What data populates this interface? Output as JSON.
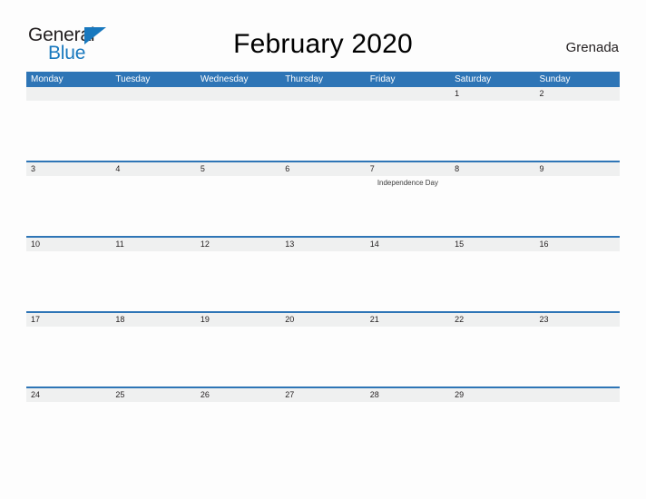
{
  "brand": {
    "name_part1": "General",
    "name_part2": "Blue",
    "flag_icon": "blue-triangle-flag",
    "accent_color": "#1878be"
  },
  "header": {
    "title": "February 2020",
    "region": "Grenada"
  },
  "theme": {
    "header_blue": "#2e75b6",
    "band_gray": "#eff0f0",
    "page_background": "#fdfdfd",
    "text_color": "#231f20"
  },
  "calendar": {
    "month": "February",
    "year": "2020",
    "weekday_headers": [
      "Monday",
      "Tuesday",
      "Wednesday",
      "Thursday",
      "Friday",
      "Saturday",
      "Sunday"
    ],
    "weeks": [
      {
        "days": [
          {
            "number": "",
            "event": ""
          },
          {
            "number": "",
            "event": ""
          },
          {
            "number": "",
            "event": ""
          },
          {
            "number": "",
            "event": ""
          },
          {
            "number": "",
            "event": ""
          },
          {
            "number": "1",
            "event": ""
          },
          {
            "number": "2",
            "event": ""
          }
        ]
      },
      {
        "days": [
          {
            "number": "3",
            "event": ""
          },
          {
            "number": "4",
            "event": ""
          },
          {
            "number": "5",
            "event": ""
          },
          {
            "number": "6",
            "event": ""
          },
          {
            "number": "7",
            "event": "Independence Day"
          },
          {
            "number": "8",
            "event": ""
          },
          {
            "number": "9",
            "event": ""
          }
        ]
      },
      {
        "days": [
          {
            "number": "10",
            "event": ""
          },
          {
            "number": "11",
            "event": ""
          },
          {
            "number": "12",
            "event": ""
          },
          {
            "number": "13",
            "event": ""
          },
          {
            "number": "14",
            "event": ""
          },
          {
            "number": "15",
            "event": ""
          },
          {
            "number": "16",
            "event": ""
          }
        ]
      },
      {
        "days": [
          {
            "number": "17",
            "event": ""
          },
          {
            "number": "18",
            "event": ""
          },
          {
            "number": "19",
            "event": ""
          },
          {
            "number": "20",
            "event": ""
          },
          {
            "number": "21",
            "event": ""
          },
          {
            "number": "22",
            "event": ""
          },
          {
            "number": "23",
            "event": ""
          }
        ]
      },
      {
        "days": [
          {
            "number": "24",
            "event": ""
          },
          {
            "number": "25",
            "event": ""
          },
          {
            "number": "26",
            "event": ""
          },
          {
            "number": "27",
            "event": ""
          },
          {
            "number": "28",
            "event": ""
          },
          {
            "number": "29",
            "event": ""
          },
          {
            "number": "",
            "event": ""
          }
        ]
      }
    ]
  }
}
